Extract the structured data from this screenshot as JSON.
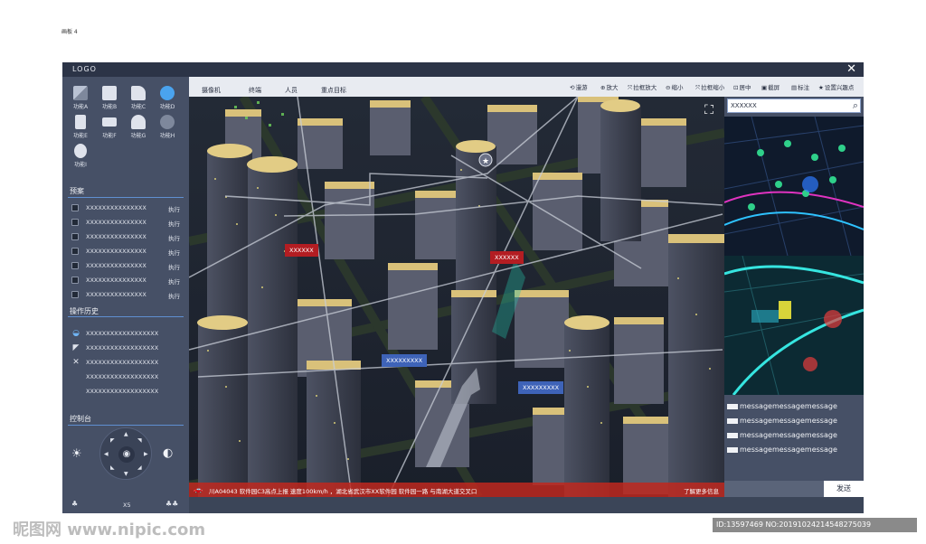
{
  "artboard_label": "画板 4",
  "titlebar": {
    "logo": "LOGO",
    "close": "✕"
  },
  "functions": [
    {
      "label": "功能A",
      "icon": "grid-icon"
    },
    {
      "label": "功能B",
      "icon": "document-icon"
    },
    {
      "label": "功能C",
      "icon": "camera-icon"
    },
    {
      "label": "功能D",
      "icon": "dome-camera-icon"
    },
    {
      "label": "功能E",
      "icon": "building-icon"
    },
    {
      "label": "功能F",
      "icon": "camera-icon"
    },
    {
      "label": "功能G",
      "icon": "person-lock-icon"
    },
    {
      "label": "功能H",
      "icon": "radar-icon"
    },
    {
      "label": "功能I",
      "icon": "users-icon"
    }
  ],
  "plans": {
    "title": "预案",
    "action": "执行",
    "items": [
      "XXXXXXXXXXXXXXX",
      "XXXXXXXXXXXXXXX",
      "XXXXXXXXXXXXXXX",
      "XXXXXXXXXXXXXXX",
      "XXXXXXXXXXXXXXX",
      "XXXXXXXXXXXXXXX",
      "XXXXXXXXXXXXXXX"
    ]
  },
  "history": {
    "title": "操作历史",
    "items": [
      {
        "text": "XXXXXXXXXXXXXXXXXX",
        "icon": "dome-camera-icon"
      },
      {
        "text": "XXXXXXXXXXXXXXXXXX",
        "icon": "camera-icon"
      },
      {
        "text": "XXXXXXXXXXXXXXXXXX",
        "icon": "close-icon"
      },
      {
        "text": "XXXXXXXXXXXXXXXXXX",
        "icon": ""
      },
      {
        "text": "XXXXXXXXXXXXXXXXXX",
        "icon": ""
      }
    ]
  },
  "console": {
    "title": "控制台",
    "zoom": "X5"
  },
  "tabs": [
    "摄像机",
    "终端",
    "人员",
    "重点目标"
  ],
  "tools": [
    {
      "label": "漫游",
      "icon": "roam-icon"
    },
    {
      "label": "放大",
      "icon": "zoom-in-icon"
    },
    {
      "label": "拉框放大",
      "icon": "box-zoom-in-icon"
    },
    {
      "label": "缩小",
      "icon": "zoom-out-icon"
    },
    {
      "label": "拉框缩小",
      "icon": "box-zoom-out-icon"
    },
    {
      "label": "居中",
      "icon": "center-icon"
    },
    {
      "label": "截屏",
      "icon": "screenshot-icon"
    },
    {
      "label": "标注",
      "icon": "annotation-icon"
    },
    {
      "label": "设置兴趣点",
      "icon": "star-icon"
    }
  ],
  "map_markers": [
    {
      "label": "XXXXXX",
      "type": "red"
    },
    {
      "label": "XXXXXX",
      "type": "red"
    },
    {
      "label": "XXXXXXXXX",
      "type": "blue"
    },
    {
      "label": "XXXXXXXXX",
      "type": "blue"
    }
  ],
  "alert": {
    "message": "川A04043 软件园C3高点上报 速度100km/h ，湖北省武汉市XX软件园 软件园一路 与南湖大道交叉口",
    "more": "了解更多信息"
  },
  "right_panel": {
    "search_value": "XXXXXX",
    "messages": [
      "messagemessagemessage",
      "messagemessagemessage",
      "messagemessagemessage",
      "messagemessagemessage"
    ],
    "send_label": "发送"
  },
  "watermark": {
    "left": "昵图网 www.nipic.com",
    "right": "ID:13597469 NO:20191024214548275039"
  },
  "colors": {
    "accent": "#5f8fd0",
    "alert_red": "#b31d22",
    "marker_blue": "#3e63b8",
    "panel": "#465066"
  }
}
